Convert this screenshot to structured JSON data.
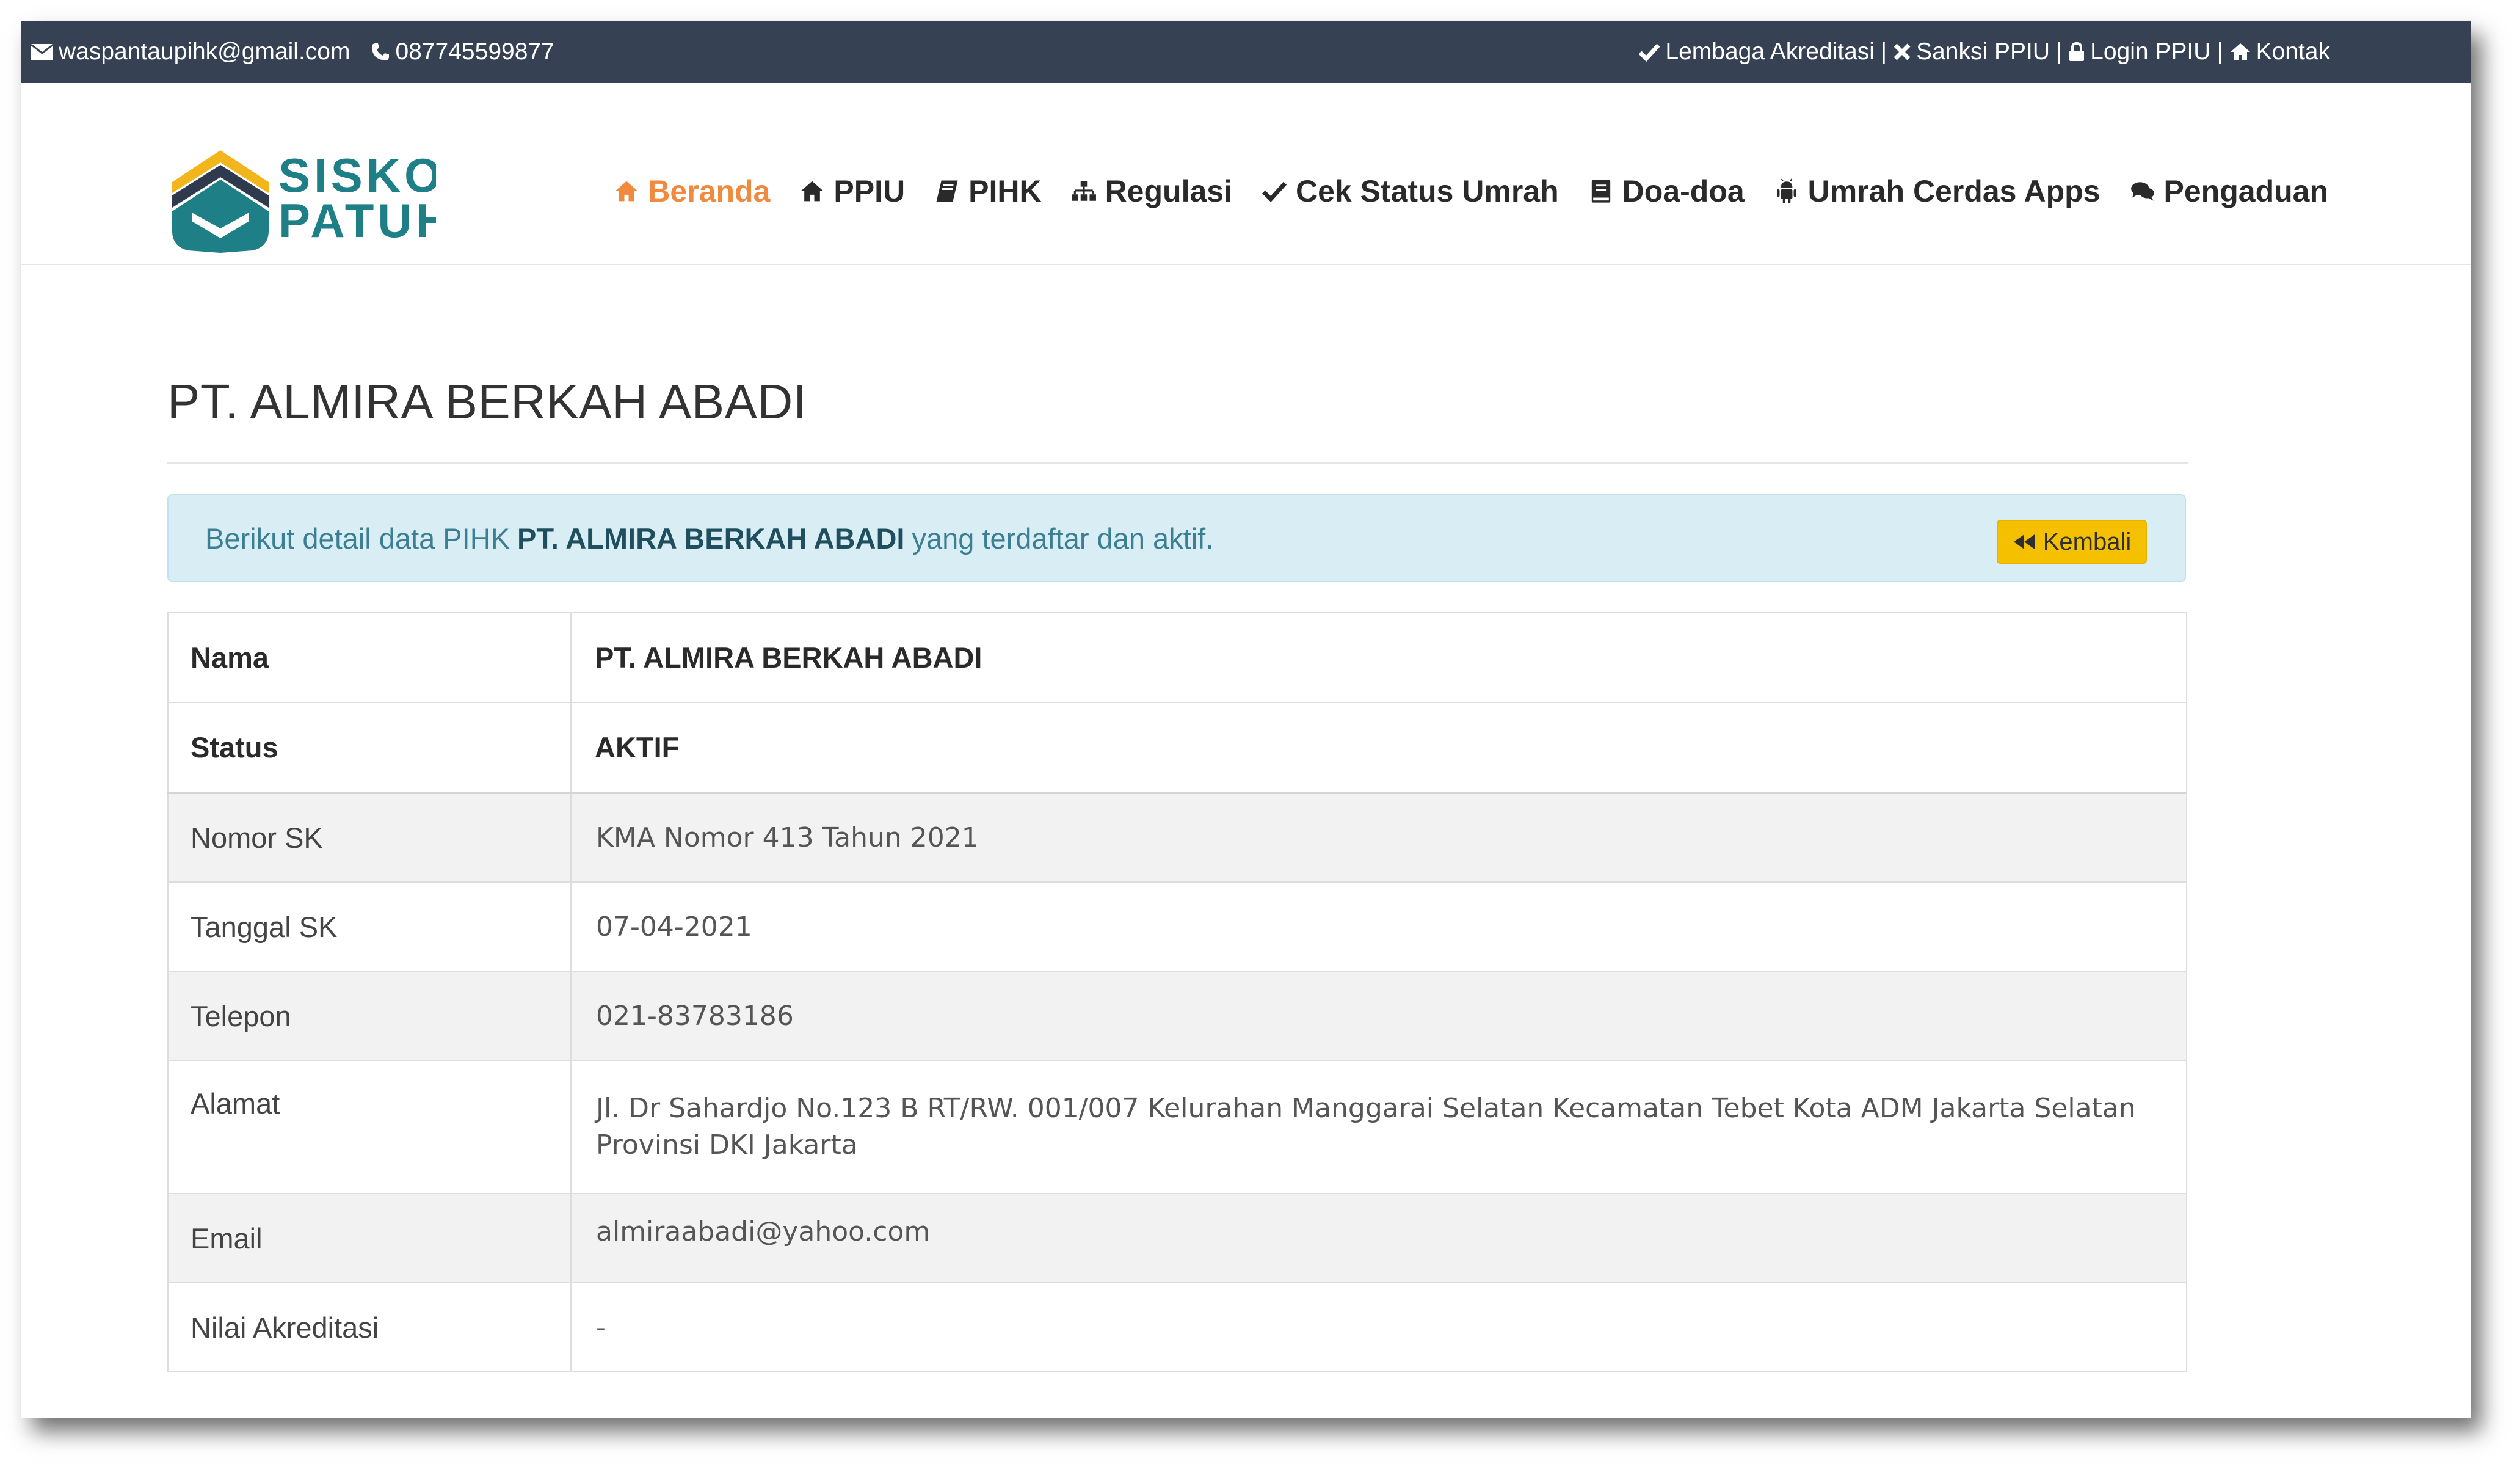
{
  "topbar": {
    "email": "waspantaupihk@gmail.com",
    "phone": "087745599877",
    "links": [
      {
        "label": "Lembaga Akreditasi",
        "icon": "check-icon"
      },
      {
        "label": "Sanksi PPIU",
        "icon": "close-icon"
      },
      {
        "label": "Login PPIU",
        "icon": "lock-icon"
      },
      {
        "label": "Kontak",
        "icon": "home-icon"
      }
    ],
    "separator": "|"
  },
  "logo": {
    "line1": "SISKO",
    "line2": "PATUH",
    "colors": {
      "teal": "#1f7f86",
      "yellow": "#f2b51c",
      "navy": "#2f3a4e"
    }
  },
  "nav": {
    "items": [
      {
        "label": "Beranda",
        "icon": "home-icon",
        "active": true
      },
      {
        "label": "PPIU",
        "icon": "home-icon",
        "active": false
      },
      {
        "label": "PIHK",
        "icon": "book-icon",
        "active": false
      },
      {
        "label": "Regulasi",
        "icon": "sitemap-icon",
        "active": false
      },
      {
        "label": "Cek Status Umrah",
        "icon": "check-icon",
        "active": false
      },
      {
        "label": "Doa-doa",
        "icon": "book-icon",
        "active": false
      },
      {
        "label": "Umrah Cerdas Apps",
        "icon": "android-icon",
        "active": false
      },
      {
        "label": "Pengaduan",
        "icon": "comments-icon",
        "active": false
      }
    ],
    "active_color": "#f08a3e"
  },
  "page": {
    "title": "PT. ALMIRA BERKAH ABADI"
  },
  "alert": {
    "prefix": "Berikut detail data PIHK",
    "company": "PT. ALMIRA BERKAH ABADI",
    "suffix": "yang terdaftar dan aktif.",
    "back_label": "Kembali"
  },
  "detail": {
    "nama_label": "Nama",
    "nama_value": "PT. ALMIRA BERKAH ABADI",
    "status_label": "Status",
    "status_value": "AKTIF",
    "nomor_sk_label": "Nomor SK",
    "nomor_sk_value": "KMA Nomor 413 Tahun 2021",
    "tanggal_sk_label": "Tanggal SK",
    "tanggal_sk_value": "07-04-2021",
    "telepon_label": "Telepon",
    "telepon_value": "021-83783186",
    "alamat_label": "Alamat",
    "alamat_line1": "Jl. Dr Sahardjo No.123 B RT/RW. 001/007 Kelurahan Manggarai Selatan Kecamatan Tebet Kota ADM Jakarta Selatan",
    "alamat_line2": "Provinsi DKI Jakarta",
    "email_label": "Email",
    "email_value": "almiraabadi@yahoo.com",
    "akreditasi_label": "Nilai Akreditasi",
    "akreditasi_value": "-"
  }
}
